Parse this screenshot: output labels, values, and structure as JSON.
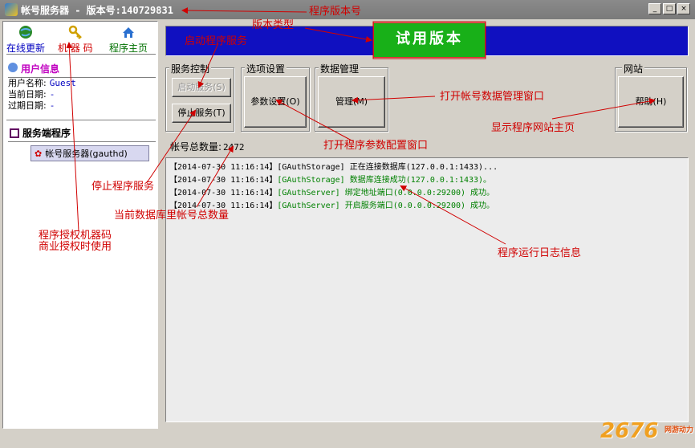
{
  "title": "帐号服务器 - 版本号:140729831",
  "window_controls": [
    "_",
    "□",
    "×"
  ],
  "toolbar": [
    {
      "label": "在线更新",
      "icon": "globe-icon"
    },
    {
      "label": "机 器 码",
      "icon": "key-icon"
    },
    {
      "label": "程序主页",
      "icon": "home-icon"
    }
  ],
  "user_info": {
    "header": "用户信息",
    "rows": [
      {
        "label": "用户名称:",
        "value": "Guest"
      },
      {
        "label": "当前日期:",
        "value": "-"
      },
      {
        "label": "过期日期:",
        "value": "-"
      }
    ]
  },
  "tree": {
    "root": "服务端程序",
    "node": "帐号服务器(gauthd)"
  },
  "banner": "试用版本",
  "groups": {
    "service": {
      "label": "服务控制",
      "start": "启动服务(S)",
      "stop": "停止服务(T)"
    },
    "options": {
      "label": "选项设置",
      "params": "参数设置(O)"
    },
    "data": {
      "label": "数据管理",
      "manage": "管理(M)"
    },
    "website": {
      "label": "网站",
      "help": "帮助(H)"
    }
  },
  "account_count": {
    "label": "帐号总数量:",
    "value": "2472"
  },
  "log": [
    {
      "ts": "【2014-07-30 11:16:14】",
      "src": "[GAuthStorage]",
      "msg": "正在连接数据库(127.0.0.1:1433)...",
      "color": "#000000"
    },
    {
      "ts": "【2014-07-30 11:16:14】",
      "src": "[GAuthStorage]",
      "msg": "数据库连接成功(127.0.0.1:1433)。",
      "color": "#008000"
    },
    {
      "ts": "【2014-07-30 11:16:14】",
      "src": "[GAuthServer]",
      "msg": "绑定地址端口(0.0.0.0:29200) 成功。",
      "color": "#008000"
    },
    {
      "ts": "【2014-07-30 11:16:14】",
      "src": "[GAuthServer]",
      "msg": "开启服务端口(0.0.0.0:29200) 成功。",
      "color": "#008000"
    }
  ],
  "annotations": {
    "version_no": "程序版本号",
    "version_type": "版本类型",
    "start_service": "启动程序服务",
    "manage_window": "打开帐号数据管理窗口",
    "show_homepage": "显示程序网站主页",
    "param_window": "打开程序参数配置窗口",
    "stop_service": "停止程序服务",
    "account_total": "当前数据库里帐号总数量",
    "machine_code_1": "程序授权机器码",
    "machine_code_2": "商业授权时使用",
    "log_info": "程序运行日志信息"
  },
  "watermark": {
    "logo": "2676",
    "sub": "网游动力"
  },
  "colors": {
    "banner_bg": "#1010c0",
    "banner_box": "#18b018",
    "annotation": "#d00000"
  }
}
